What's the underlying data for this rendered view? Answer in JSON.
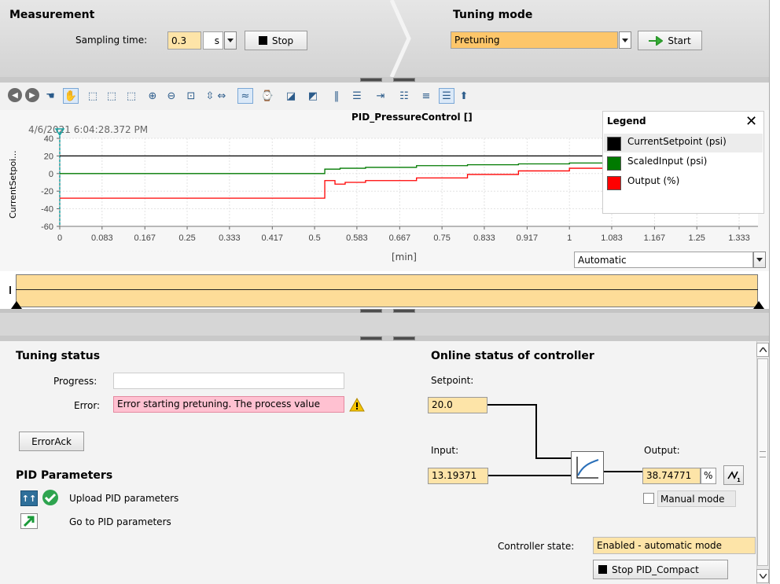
{
  "measurement": {
    "title": "Measurement",
    "sampling_label": "Sampling time:",
    "sampling_value": "0.3",
    "sampling_unit": "s",
    "stop_label": "Stop"
  },
  "tuning_mode": {
    "title": "Tuning mode",
    "selected": "Pretuning",
    "start_label": "Start"
  },
  "toolbar": {
    "icons": [
      "back-icon",
      "forward-icon",
      "hand-pointer-icon",
      "pan-icon",
      "zoom-region-icon",
      "zoom-x-icon",
      "zoom-y-icon",
      "zoom-in-icon",
      "zoom-out-icon",
      "zoom-100-icon",
      "scale-y-icon",
      "scale-x-icon",
      "signal-icon",
      "time-stamp-icon",
      "line-style-icon",
      "step-style-icon",
      "cursor-vertical-icon",
      "cursor-horizontal-icon",
      "auto-scroll-icon",
      "legend-list-icon",
      "legend-left-icon",
      "legend-right-icon",
      "export-icon"
    ]
  },
  "chart": {
    "title": "PID_PressureControl []",
    "timestamp": "4/6/2021 6:04:28.372 PM",
    "ylabel": "CurrentSetpoi...",
    "xlabel": "[min]",
    "scale_mode": "Automatic"
  },
  "chart_data": {
    "type": "line",
    "title": "PID_PressureControl []",
    "xlabel": "[min]",
    "ylabel": "CurrentSetpoi...",
    "xlim": [
      0,
      1.37
    ],
    "ylim": [
      -60,
      40
    ],
    "x_ticks": [
      "0",
      "0.083",
      "0.167",
      "0.25",
      "0.333",
      "0.417",
      "0.5",
      "0.583",
      "0.667",
      "0.75",
      "0.833",
      "0.917",
      "1",
      "1.083",
      "1.167",
      "1.25",
      "1.333"
    ],
    "y_ticks": [
      "40",
      "20",
      "0",
      "-20",
      "-40",
      "-60"
    ],
    "grid": true,
    "legend_position": "top-right",
    "series": [
      {
        "name": "CurrentSetpoint (psi)",
        "color": "#000000",
        "x": [
          0,
          1.11
        ],
        "y": [
          20,
          20
        ]
      },
      {
        "name": "ScaledInput (psi)",
        "color": "#007a00",
        "x": [
          0,
          0.51,
          0.52,
          0.54,
          0.55,
          0.6,
          0.7,
          0.8,
          0.9,
          1.0,
          1.11
        ],
        "y": [
          0,
          0,
          5,
          5,
          6,
          7,
          9,
          10,
          11,
          12,
          13
        ]
      },
      {
        "name": "Output (%)",
        "color": "#ff0000",
        "x": [
          0,
          0.5,
          0.52,
          0.54,
          0.56,
          0.6,
          0.7,
          0.8,
          0.9,
          1.0,
          1.11
        ],
        "y": [
          -28,
          -28,
          -8,
          -12,
          -10,
          -8,
          -5,
          -1,
          3,
          6,
          8
        ]
      }
    ]
  },
  "legend": {
    "title": "Legend",
    "items": [
      {
        "label": "CurrentSetpoint (psi)",
        "color": "#000000"
      },
      {
        "label": "ScaledInput (psi)",
        "color": "#007a00"
      },
      {
        "label": "Output (%)",
        "color": "#ff0000"
      }
    ]
  },
  "tuning_status": {
    "title": "Tuning status",
    "progress_label": "Progress:",
    "progress_value": 0,
    "error_label": "Error:",
    "error_value": "Error starting pretuning. The process value",
    "errorack_label": "ErrorAck"
  },
  "pid_params": {
    "title": "PID Parameters",
    "upload_label": "Upload PID parameters",
    "goto_label": "Go to PID parameters"
  },
  "online_status": {
    "title": "Online status of controller",
    "setpoint_label": "Setpoint:",
    "setpoint_value": "20.0",
    "input_label": "Input:",
    "input_value": "13.19371",
    "output_label": "Output:",
    "output_value": "38.74771",
    "output_unit": "%",
    "manual_label": "Manual mode",
    "state_label": "Controller state:",
    "state_value": "Enabled - automatic mode",
    "stop_pid_label": "Stop PID_Compact"
  }
}
